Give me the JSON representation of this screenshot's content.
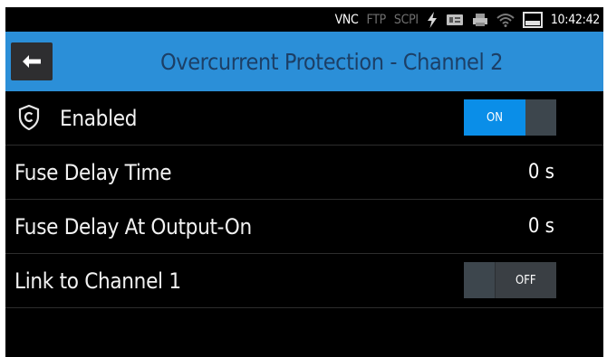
{
  "status_bar": {
    "vnc": "VNC",
    "ftp": "FTP",
    "scpi": "SCPI",
    "time": "10:42:42",
    "icons": [
      "lightning-icon",
      "usb-icon",
      "printer-icon",
      "wifi-icon",
      "display-icon"
    ]
  },
  "header": {
    "title": "Overcurrent Protection - Channel 2",
    "back_icon": "arrow-left-icon"
  },
  "settings": {
    "enabled": {
      "label": "Enabled",
      "toggle_label": "ON",
      "icon": "shield-icon",
      "state": "on"
    },
    "fuse_delay_time": {
      "label": "Fuse Delay Time",
      "value": "0 s"
    },
    "fuse_delay_output_on": {
      "label": "Fuse Delay At Output-On",
      "value": "0 s"
    },
    "link_channel": {
      "label": "Link to Channel 1",
      "toggle_label": "OFF",
      "state": "off"
    }
  },
  "colors": {
    "header_bg": "#2b8fd8",
    "title_text": "#1c3f66",
    "toggle_on": "#0a8ee8",
    "background": "#000000"
  }
}
